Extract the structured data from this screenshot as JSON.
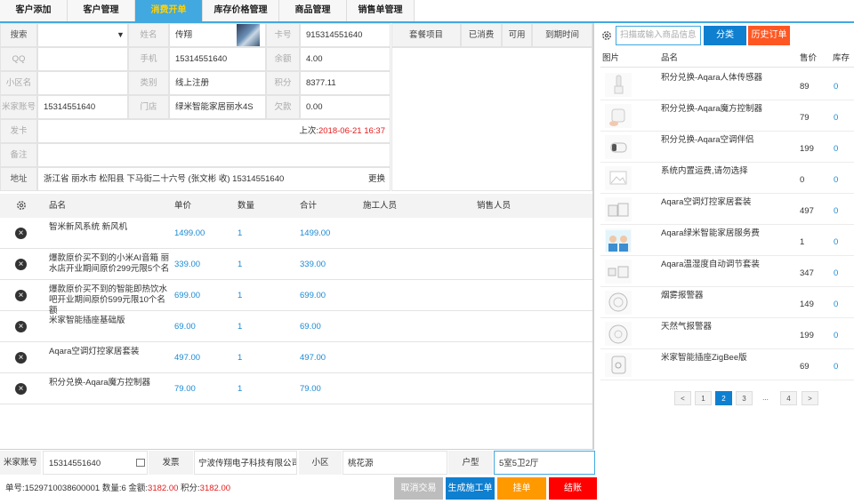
{
  "tabs": [
    "客户添加",
    "客户管理",
    "消费开单",
    "库存价格管理",
    "商品管理",
    "销售单管理"
  ],
  "customer": {
    "search_label": "搜索",
    "name_label": "姓名",
    "name": "传翔",
    "card_label": "卡号",
    "card": "915314551640",
    "qq_label": "QQ",
    "phone_label": "手机",
    "phone": "15314551640",
    "balance_label": "余额",
    "balance": "4.00",
    "community_label": "小区名",
    "type_label": "类别",
    "type": "线上注册",
    "points_label": "积分",
    "points": "8377.11",
    "mi_label": "米家账号",
    "mi": "15314551640",
    "store_label": "门店",
    "store": "绿米智能家居丽水4S",
    "debt_label": "欠款",
    "debt": "0.00",
    "invoice_label": "发卡",
    "last_visit_label": "上次:",
    "last_visit": "2018-06-21 16:37",
    "note_label": "备注",
    "address_label": "地址",
    "address": "浙江省 丽水市 松阳县 下马街二十六号 (张文彬 收) 15314551640",
    "change_label": "更换"
  },
  "packages": {
    "headers": [
      "套餐项目",
      "已消费",
      "可用",
      "到期时间"
    ]
  },
  "items": {
    "headers": [
      "品名",
      "单价",
      "数量",
      "合计",
      "施工人员",
      "销售人员"
    ],
    "rows": [
      {
        "name": "智米新风系统 新风机",
        "price": "1499.00",
        "qty": "1",
        "total": "1499.00"
      },
      {
        "name": "爆款原价买不到的小米AI音箱 丽水店开业期间原价299元限5个名",
        "price": "339.00",
        "qty": "1",
        "total": "339.00"
      },
      {
        "name": "爆款原价买不到的智能即热饮水吧开业期间原价599元限10个名额",
        "price": "699.00",
        "qty": "1",
        "total": "699.00"
      },
      {
        "name": "米家智能插座基础版",
        "price": "69.00",
        "qty": "1",
        "total": "69.00"
      },
      {
        "name": "Aqara空调灯控家居套装",
        "price": "497.00",
        "qty": "1",
        "total": "497.00"
      },
      {
        "name": "积分兑换-Aqara魔方控制器",
        "price": "79.00",
        "qty": "1",
        "total": "79.00"
      }
    ]
  },
  "products": {
    "search_placeholder": "扫描或输入商品信息",
    "category_label": "分类",
    "history_label": "历史订单",
    "headers": [
      "图片",
      "品名",
      "售价",
      "库存"
    ],
    "rows": [
      {
        "name": "积分兑换-Aqara人体传感器",
        "price": "89",
        "stock": "0"
      },
      {
        "name": "积分兑换-Aqara魔方控制器",
        "price": "79",
        "stock": "0"
      },
      {
        "name": "积分兑换-Aqara空调伴侣",
        "price": "199",
        "stock": "0"
      },
      {
        "name": "系统内置运费,请勿选择",
        "price": "0",
        "stock": "0"
      },
      {
        "name": "Aqara空调灯控家居套装",
        "price": "497",
        "stock": "0"
      },
      {
        "name": "Aqara绿米智能家居服务费",
        "price": "1",
        "stock": "0"
      },
      {
        "name": "Aqara温湿度自动调节套装",
        "price": "347",
        "stock": "0"
      },
      {
        "name": "烟雾报警器",
        "price": "149",
        "stock": "0"
      },
      {
        "name": "天然气报警器",
        "price": "199",
        "stock": "0"
      },
      {
        "name": "米家智能插座ZigBee版",
        "price": "69",
        "stock": "0"
      }
    ],
    "pagination": [
      "<",
      "1",
      "2",
      "3",
      "...",
      "4",
      ">"
    ]
  },
  "footer": {
    "mi_label": "米家账号",
    "mi": "15314551640",
    "invoice_label": "发票",
    "invoice": "宁波传翔电子科技有限公司",
    "community_label": "小区",
    "community": "桃花源",
    "house_label": "户型",
    "house": "5室5卫2厅",
    "order_label": "单号:",
    "order_no": "1529710038600001",
    "count_label": "数量:",
    "count": "6",
    "amount_label": "金额:",
    "amount": "3182.00",
    "points_label": "积分:",
    "points": "3182.00",
    "cancel_label": "取消交易",
    "work_label": "生成施工单",
    "hold_label": "挂单",
    "checkout_label": "结账"
  },
  "colors": {
    "accent": "#42a8e0",
    "tab_active_text": "#ffd200",
    "orange": "#ff9900",
    "red": "#ff0000",
    "blue_btn": "#0f7fd0"
  }
}
